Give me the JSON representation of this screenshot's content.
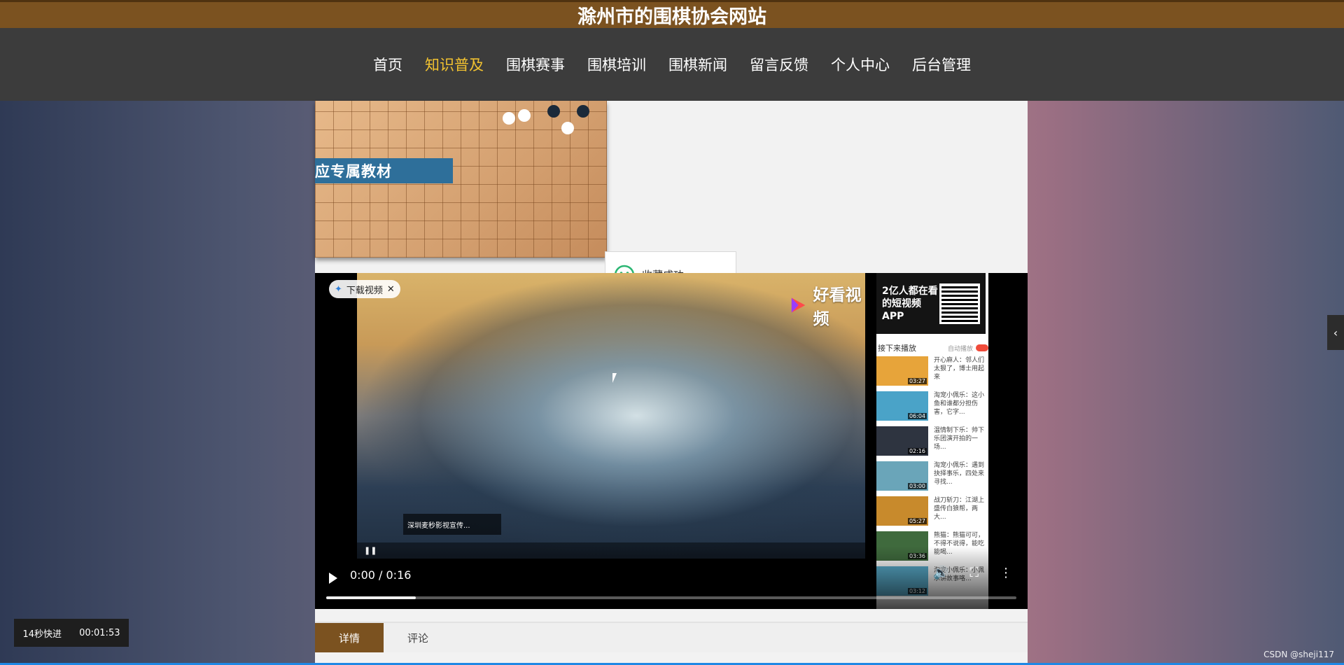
{
  "site": {
    "title": "滁州市的围棋协会网站"
  },
  "nav": {
    "items": [
      {
        "label": "首页",
        "active": false
      },
      {
        "label": "知识普及",
        "active": true
      },
      {
        "label": "围棋赛事",
        "active": false
      },
      {
        "label": "围棋培训",
        "active": false
      },
      {
        "label": "围棋新闻",
        "active": false
      },
      {
        "label": "留言反馈",
        "active": false
      },
      {
        "label": "个人中心",
        "active": false
      },
      {
        "label": "后台管理",
        "active": false
      }
    ]
  },
  "banner": {
    "label": "应专属教材"
  },
  "toast": {
    "message": "收藏成功"
  },
  "video": {
    "download_label": "下载视频",
    "brand": "好看视频",
    "ad_text": "深圳麦秒影视宣传...",
    "sidebar": {
      "ad_text": "2亿人都在看的短视频APP",
      "upnext_title": "接下来播放",
      "autoplay_label": "自动播放",
      "items": [
        {
          "text": "开心麻人：邻人们太狠了，博士用起来",
          "duration": "03:27",
          "thumb": "#e7a43a"
        },
        {
          "text": "淘宠小佩乐：这小鱼和谁都分担伤害，它字...",
          "duration": "06:04",
          "thumb": "#4aa3c8"
        },
        {
          "text": "温情制下乐：帅下乐团演开拍的一场...",
          "duration": "02:16",
          "thumb": "#2e3440"
        },
        {
          "text": "淘宠小佩乐：遇到抉择事乐，四处来寻找...",
          "duration": "03:00",
          "thumb": "#6aa5b9"
        },
        {
          "text": "战刀斩刀：江湖上盛传白狼帮，两大...",
          "duration": "05:27",
          "thumb": "#c88a2c"
        },
        {
          "text": "熊猫：熊猫可可，不得不说得，能吃能喝...",
          "duration": "03:36",
          "thumb": "#3f6a3d"
        },
        {
          "text": "淘宠小佩乐：小佩乐讲故事咯...",
          "duration": "03:12",
          "thumb": "#5bb0d0"
        }
      ]
    }
  },
  "player": {
    "time": "0:00 / 0:16",
    "progress_fraction": 0.13
  },
  "tabs": [
    {
      "label": "详情",
      "active": true
    },
    {
      "label": "评论",
      "active": false
    }
  ],
  "status": {
    "fast_forward": "14秒快进",
    "elapsed": "00:01:53"
  },
  "watermark": "CSDN @sheji117"
}
